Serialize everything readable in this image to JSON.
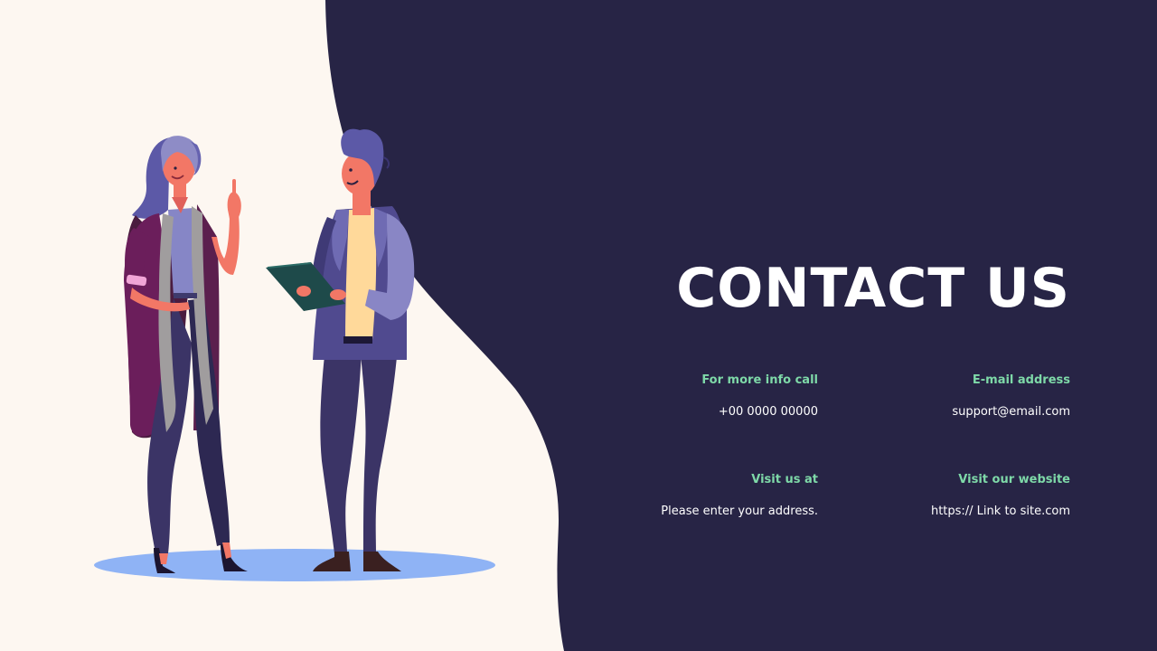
{
  "slide": {
    "title": "CONTACT US",
    "contacts": {
      "call": {
        "label": "For more info call",
        "value": "+00 0000 00000"
      },
      "email": {
        "label": "E-mail address",
        "value": "support@email.com"
      },
      "visit": {
        "label": "Visit us at",
        "value": "Please enter your address."
      },
      "website": {
        "label": "Visit our website",
        "value": "https:// Link to site.com"
      }
    }
  },
  "colors": {
    "background": "#fdf7f1",
    "panel": "#272445",
    "accent": "#7ed9a8",
    "title": "#ffffff"
  },
  "illustration": {
    "icons": [
      "woman-figure",
      "man-figure",
      "clipboard-icon",
      "floor-shadow"
    ]
  }
}
